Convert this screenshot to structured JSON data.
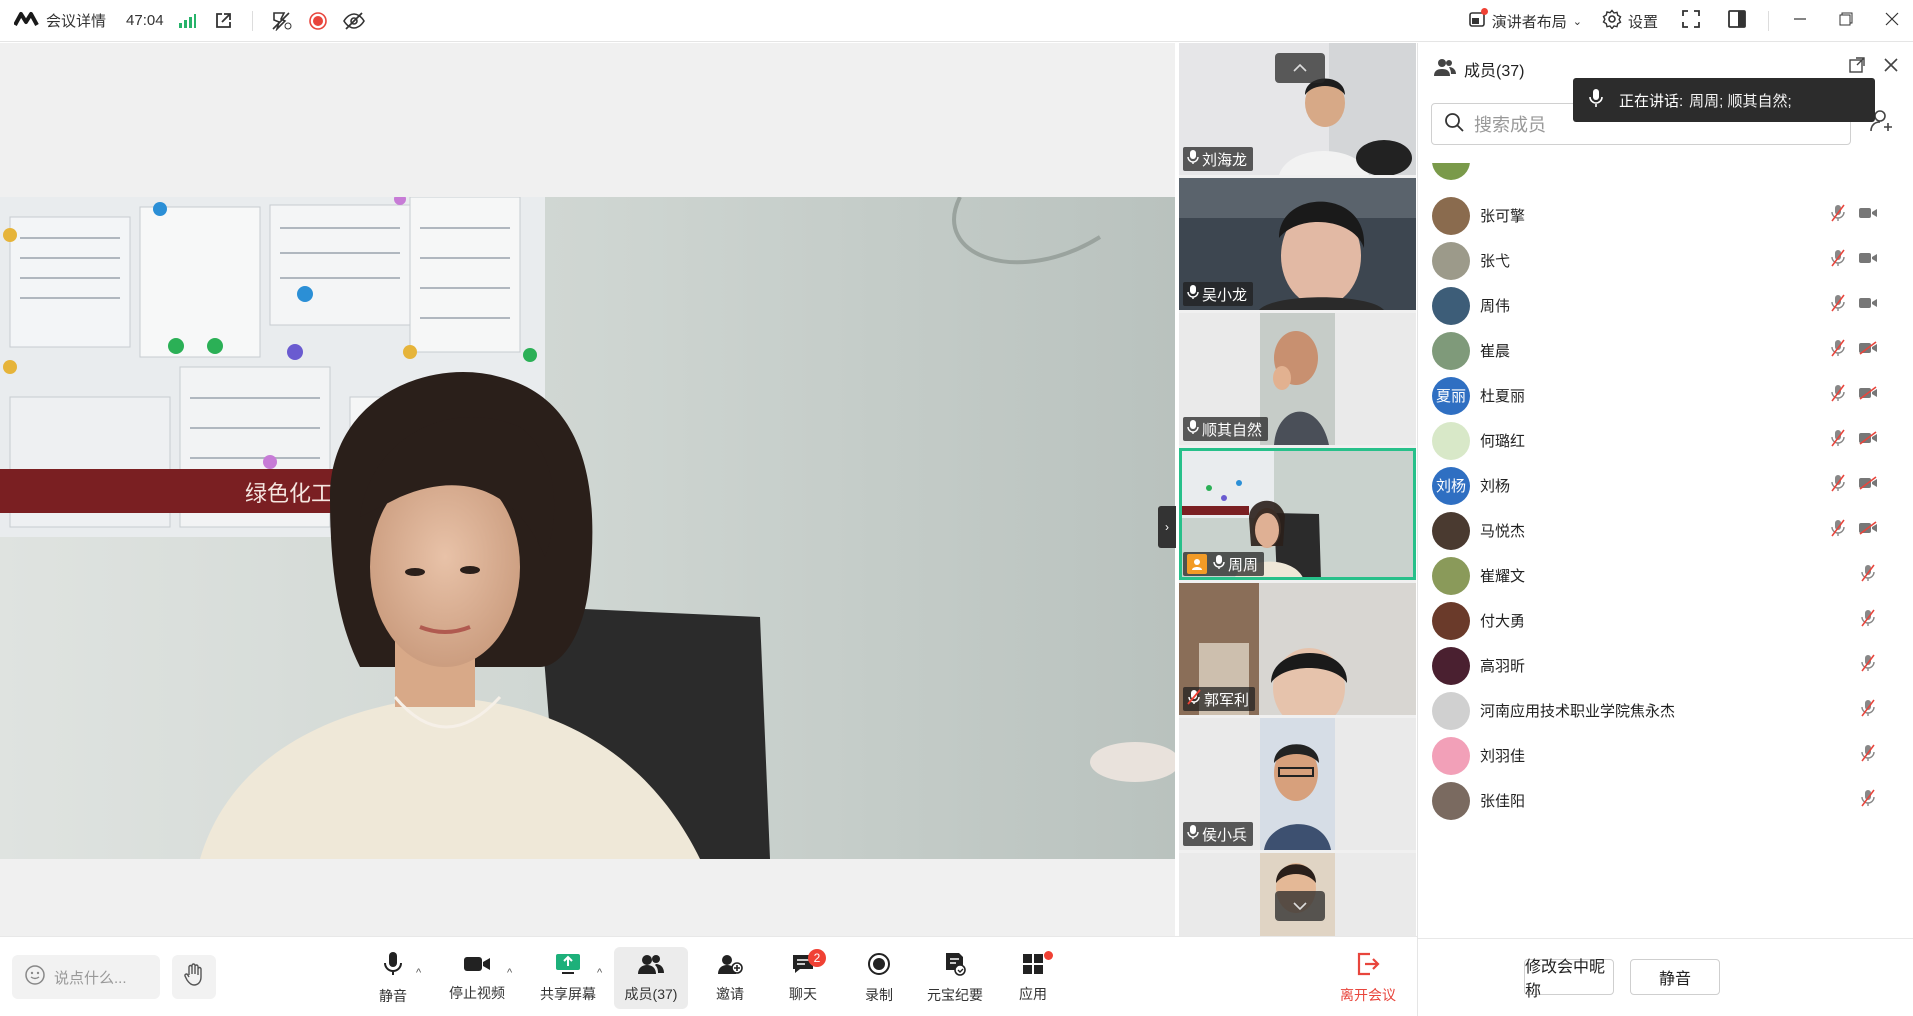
{
  "topbar": {
    "meeting_details": "会议详情",
    "timer": "47:04",
    "layout_label": "演讲者布局",
    "settings_label": "设置"
  },
  "speaking": {
    "prefix": "正在讲话:",
    "names": "周周; 顺其自然;"
  },
  "main_video": {
    "banner_text": "绿色化工"
  },
  "thumbnails": [
    {
      "name": "刘海龙",
      "mic": "on"
    },
    {
      "name": "吴小龙",
      "mic": "on"
    },
    {
      "name": "顺其自然",
      "mic": "on"
    },
    {
      "name": "周周",
      "mic": "on",
      "host": true,
      "active": true
    },
    {
      "name": "郭军利",
      "mic": "off"
    },
    {
      "name": "侯小兵",
      "mic": "on"
    }
  ],
  "toolbar": {
    "chat_placeholder": "说点什么...",
    "mute": "静音",
    "stop_video": "停止视频",
    "share_screen": "共享屏幕",
    "members": "成员(37)",
    "invite": "邀请",
    "chat": "聊天",
    "chat_badge": "2",
    "record": "录制",
    "minutes": "元宝纪要",
    "apps": "应用",
    "leave": "离开会议"
  },
  "panel": {
    "title": "成员(37)",
    "search_placeholder": "搜索成员",
    "rename_button": "修改会中昵称",
    "mute_button": "静音",
    "members": [
      {
        "name": "张可擎",
        "avatar_text": "",
        "avatar_color": "#8a6b4e",
        "camera": "on"
      },
      {
        "name": "张弋",
        "avatar_text": "",
        "avatar_color": "#9c9a8a",
        "camera": "on"
      },
      {
        "name": "周伟",
        "avatar_text": "",
        "avatar_color": "#3d5d78",
        "camera": "on"
      },
      {
        "name": "崔晨",
        "avatar_text": "",
        "avatar_color": "#7f9a7a",
        "camera": "off"
      },
      {
        "name": "杜夏丽",
        "avatar_text": "夏丽",
        "avatar_color": "#2f6fc2",
        "camera": "off"
      },
      {
        "name": "何璐红",
        "avatar_text": "",
        "avatar_color": "#d8e8c8",
        "camera": "off"
      },
      {
        "name": "刘杨",
        "avatar_text": "刘杨",
        "avatar_color": "#2f6fc2",
        "camera": "off"
      },
      {
        "name": "马悦杰",
        "avatar_text": "",
        "avatar_color": "#4a3a30",
        "camera": "off"
      },
      {
        "name": "崔耀文",
        "avatar_text": "",
        "avatar_color": "#8a9a5a",
        "camera": "none"
      },
      {
        "name": "付大勇",
        "avatar_text": "",
        "avatar_color": "#6a3a2a",
        "camera": "none"
      },
      {
        "name": "高羽昕",
        "avatar_text": "",
        "avatar_color": "#4a2030",
        "camera": "none"
      },
      {
        "name": "河南应用技术职业学院焦永杰",
        "avatar_text": "",
        "avatar_color": "#d0d0d0",
        "camera": "none"
      },
      {
        "name": "刘羽佳",
        "avatar_text": "",
        "avatar_color": "#f2a0b8",
        "camera": "none"
      },
      {
        "name": "张佳阳",
        "avatar_text": "",
        "avatar_color": "#7a6a60",
        "camera": "none"
      }
    ]
  }
}
